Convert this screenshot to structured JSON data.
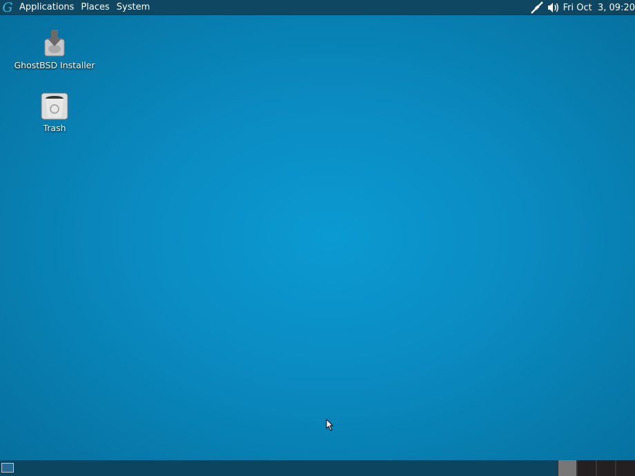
{
  "top_panel": {
    "logo": "G",
    "menus": [
      "Applications",
      "Places",
      "System"
    ],
    "clock": "Fri Oct  3, 09:20",
    "tray_icons": [
      "network-icon",
      "volume-icon"
    ]
  },
  "desktop": {
    "icons": [
      {
        "label": "GhostBSD Installer",
        "icon": "installer-icon"
      },
      {
        "label": "Trash",
        "icon": "trash-icon"
      }
    ]
  },
  "bottom_panel": {
    "workspaces": 4,
    "active_workspace": 1
  }
}
